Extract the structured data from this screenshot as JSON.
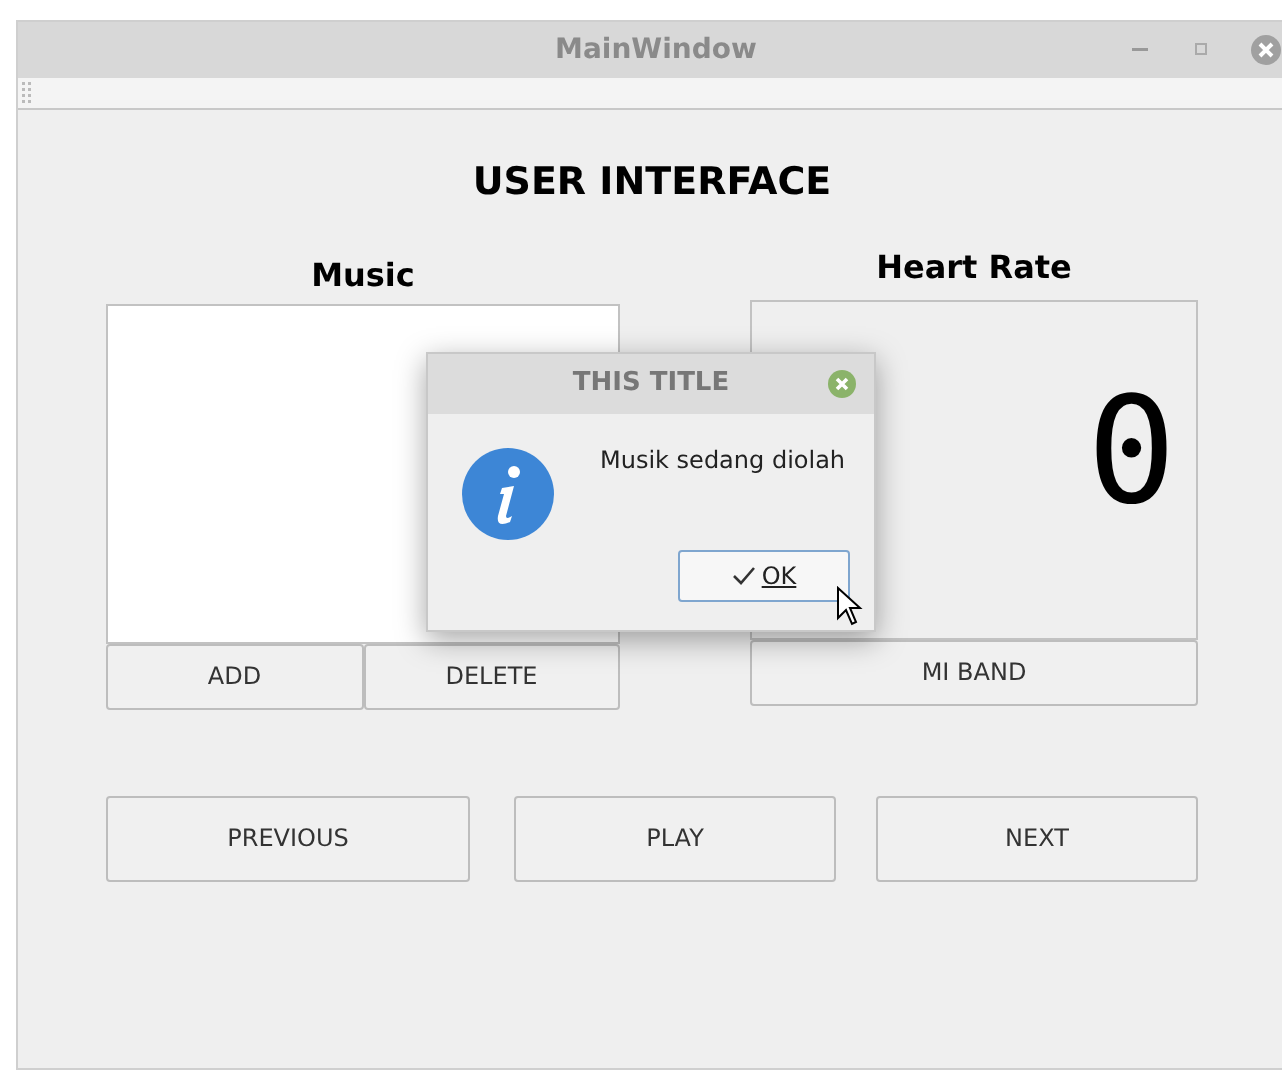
{
  "window": {
    "title": "MainWindow"
  },
  "heading": "USER INTERFACE",
  "music": {
    "label": "Music",
    "buttons": [
      "ADD",
      "DELETE"
    ]
  },
  "heart_rate": {
    "label": "Heart Rate",
    "display": "0",
    "button": "MI BAND"
  },
  "controls": [
    "PREVIOUS",
    "PLAY",
    "NEXT"
  ],
  "dialog": {
    "title": "THIS TITLE",
    "message": "Musik sedang diolah",
    "button": "OK"
  }
}
